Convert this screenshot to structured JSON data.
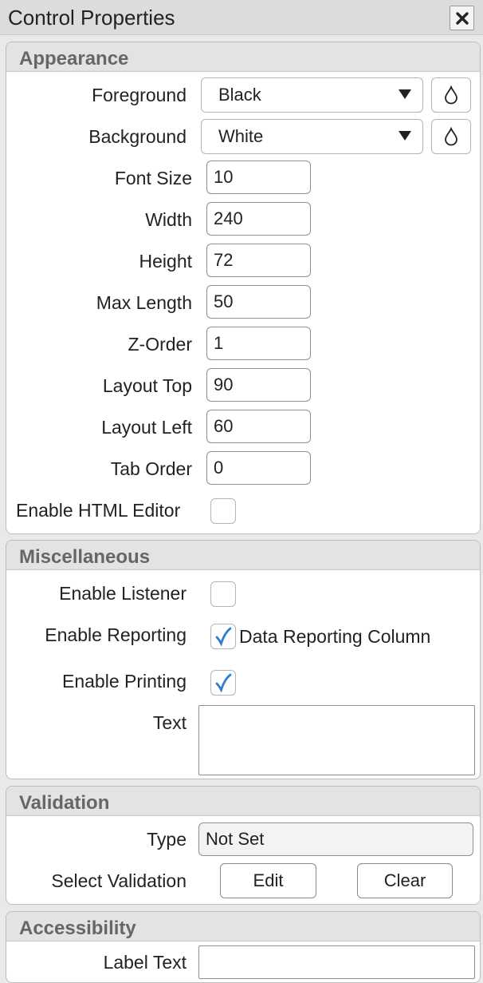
{
  "window": {
    "title": "Control Properties",
    "close_icon": "close-icon"
  },
  "appearance": {
    "header": "Appearance",
    "foreground": {
      "label": "Foreground",
      "value": "Black"
    },
    "background": {
      "label": "Background",
      "value": "White"
    },
    "font_size": {
      "label": "Font Size",
      "value": "10"
    },
    "width": {
      "label": "Width",
      "value": "240"
    },
    "height": {
      "label": "Height",
      "value": "72"
    },
    "max_length": {
      "label": "Max Length",
      "value": "50"
    },
    "z_order": {
      "label": "Z-Order",
      "value": "1"
    },
    "layout_top": {
      "label": "Layout Top",
      "value": "90"
    },
    "layout_left": {
      "label": "Layout Left",
      "value": "60"
    },
    "tab_order": {
      "label": "Tab Order",
      "value": "0"
    },
    "html_editor": {
      "label": "Enable HTML Editor",
      "checked": false
    }
  },
  "misc": {
    "header": "Miscellaneous",
    "listener": {
      "label": "Enable Listener",
      "checked": false
    },
    "reporting": {
      "label": "Enable Reporting",
      "checked": true,
      "note": "Data Reporting Column"
    },
    "printing": {
      "label": "Enable Printing",
      "checked": true
    },
    "text": {
      "label": "Text",
      "value": ""
    }
  },
  "validation": {
    "header": "Validation",
    "type": {
      "label": "Type",
      "value": "Not Set"
    },
    "select": {
      "label": "Select Validation",
      "edit": "Edit",
      "clear": "Clear"
    }
  },
  "accessibility": {
    "header": "Accessibility",
    "label_text": {
      "label": "Label Text",
      "value": ""
    }
  },
  "colors": {
    "check": "#2f7fd0",
    "header_text": "#666666"
  }
}
